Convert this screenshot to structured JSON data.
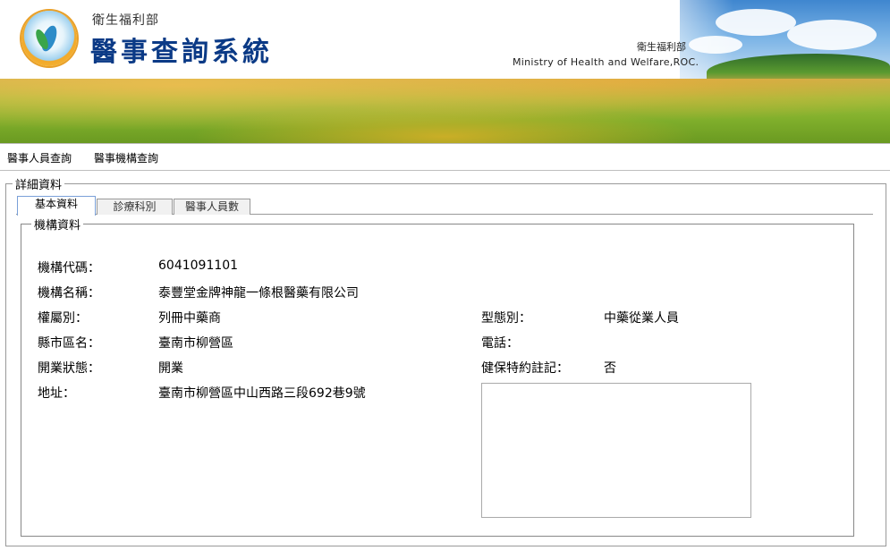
{
  "header": {
    "org_small": "衛生福利部",
    "system_title": "醫事查詢系統",
    "ministry_zh": "衛生福利部",
    "ministry_en": "Ministry of Health and Welfare,ROC."
  },
  "nav": {
    "items": [
      "醫事人員查詢",
      "醫事機構查詢"
    ]
  },
  "detail": {
    "legend": "詳細資料",
    "tabs": [
      {
        "label": "基本資料",
        "active": true
      },
      {
        "label": "診療科別",
        "active": false
      },
      {
        "label": "醫事人員數",
        "active": false
      }
    ],
    "section_legend": "機構資料",
    "fields": {
      "code": {
        "label": "機構代碼：",
        "value": "6041091101"
      },
      "name": {
        "label": "機構名稱：",
        "value": "泰豐堂金牌神龍一條根醫藥有限公司"
      },
      "ownership": {
        "label": "權屬別：",
        "value": "列冊中藥商"
      },
      "type": {
        "label": "型態別：",
        "value": "中藥從業人員"
      },
      "city": {
        "label": "縣市區名：",
        "value": "臺南市柳營區"
      },
      "phone": {
        "label": "電話：",
        "value": ""
      },
      "status": {
        "label": "開業狀態：",
        "value": "開業"
      },
      "insurance": {
        "label": "健保特約註記：",
        "value": "否"
      },
      "address": {
        "label": "地址：",
        "value": "臺南市柳營區中山西路三段692巷9號"
      }
    }
  },
  "colors": {
    "title_blue": "#0b3a86",
    "tab_active_border": "#7aa0d8"
  }
}
